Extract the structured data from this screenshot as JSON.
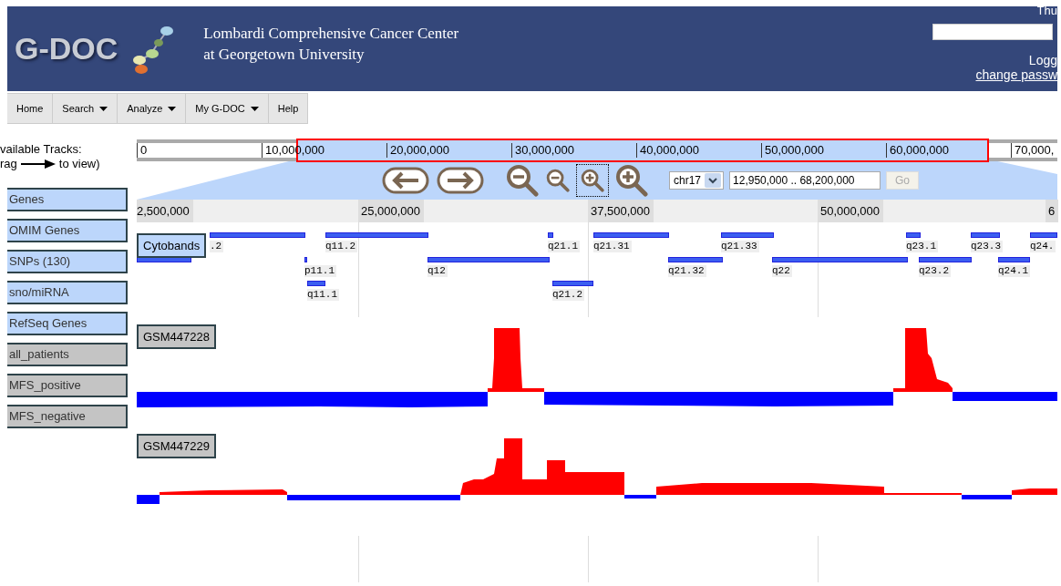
{
  "header": {
    "logo": "G-DOC",
    "org_lines": [
      "Lombardi Comprehensive Cancer Center",
      "at Georgetown University"
    ],
    "date": "Thu",
    "login_label": "Logg",
    "change_password_link": "change passw"
  },
  "nav": [
    {
      "label": "Home",
      "dropdown": false
    },
    {
      "label": "Search",
      "dropdown": true
    },
    {
      "label": "Analyze",
      "dropdown": true
    },
    {
      "label": "My G-DOC",
      "dropdown": true
    },
    {
      "label": "Help",
      "dropdown": false
    }
  ],
  "sidebar": {
    "title": "vailable Tracks:",
    "hint_before": "rag",
    "hint_after": "to view)",
    "tracks": [
      {
        "label": "Genes",
        "kind": "available"
      },
      {
        "label": "OMIM Genes",
        "kind": "available"
      },
      {
        "label": "SNPs (130)",
        "kind": "available"
      },
      {
        "label": "sno/miRNA",
        "kind": "available"
      },
      {
        "label": "RefSeq Genes",
        "kind": "available"
      },
      {
        "label": "all_patients",
        "kind": "patients"
      },
      {
        "label": "MFS_positive",
        "kind": "patients"
      },
      {
        "label": "MFS_negative",
        "kind": "patients"
      }
    ]
  },
  "overview": {
    "ticks": [
      "0",
      "10,000,000",
      "20,000,000",
      "30,000,000",
      "40,000,000",
      "50,000,000",
      "60,000,000",
      "70,000,"
    ]
  },
  "controls": {
    "pan_buttons": [
      {
        "kind": "left"
      },
      {
        "kind": "right"
      }
    ],
    "zoom_buttons": [
      {
        "kind": "out-large",
        "focused": false
      },
      {
        "kind": "out-small",
        "focused": false
      },
      {
        "kind": "in-small",
        "focused": true
      },
      {
        "kind": "in-large",
        "focused": false
      }
    ],
    "chromosome": "chr17",
    "location": "12,950,000 .. 68,200,000",
    "go": {
      "label": "Go",
      "disabled": true
    }
  },
  "detail_ruler": {
    "ticks": [
      "2,500,000",
      "25,000,000",
      "37,500,000",
      "50,000,000",
      "6"
    ]
  },
  "cytobands": {
    "label": "Cytobands",
    "bands": [
      {
        "kind": "band",
        "label": ".2"
      },
      {
        "kind": "band",
        "label": "q11.2"
      },
      {
        "kind": "band",
        "label": "q21.1"
      },
      {
        "kind": "band",
        "label": "q21.31"
      },
      {
        "kind": "band",
        "label": "q21.33"
      },
      {
        "kind": "band",
        "label": "q23.1"
      },
      {
        "kind": "band",
        "label": "q23.3"
      },
      {
        "kind": "band",
        "label": "q24."
      },
      {
        "kind": "band"
      },
      {
        "kind": "band",
        "label": "p11.1"
      },
      {
        "kind": "band",
        "label": "q12"
      },
      {
        "kind": "band",
        "label": "q21.32"
      },
      {
        "kind": "band",
        "label": "q22"
      },
      {
        "kind": "band",
        "label": "q23.2"
      },
      {
        "kind": "band",
        "label": "q24.1"
      },
      {
        "kind": "band",
        "label": "q11.1"
      },
      {
        "kind": "band",
        "label": "q21.2"
      }
    ]
  },
  "signal_tracks": [
    {
      "label": "GSM447228"
    },
    {
      "label": "GSM447229"
    }
  ]
}
